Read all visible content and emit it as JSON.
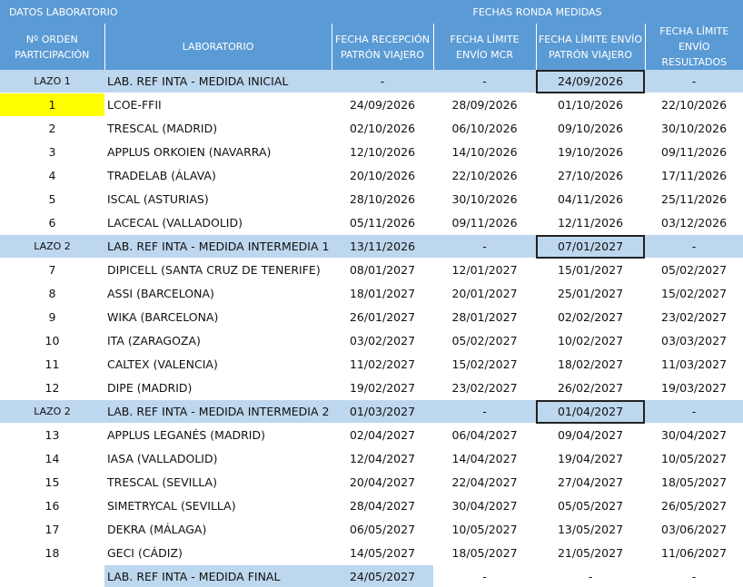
{
  "header": {
    "group_left": "DATOS LABORATORIO",
    "group_right": "FECHAS RONDA MEDIDAS",
    "col_orden": "Nº ORDEN PARTICIPACIÓN",
    "col_lab": "LABORATORIO",
    "col_recepcion": "FECHA RECEPCIÓN PATRÓN VIAJERO",
    "col_mcr": "FECHA LÍMITE ENVÍO MCR",
    "col_envio": "FECHA LÍMITE ENVÍO PATRÓN VIAJERO",
    "col_resultados": "FECHA LÍMITE ENVÍO RESULTADOS"
  },
  "rows": [
    {
      "orden": "LAZO 1",
      "lab": "LAB. REF INTA - MEDIDA INICIAL",
      "recepcion": "-",
      "mcr": "-",
      "envio": "24/09/2026",
      "resultados": "-"
    },
    {
      "orden": "1",
      "lab": "LCOE-FFII",
      "recepcion": "24/09/2026",
      "mcr": "28/09/2026",
      "envio": "01/10/2026",
      "resultados": "22/10/2026"
    },
    {
      "orden": "2",
      "lab": "TRESCAL (MADRID)",
      "recepcion": "02/10/2026",
      "mcr": "06/10/2026",
      "envio": "09/10/2026",
      "resultados": "30/10/2026"
    },
    {
      "orden": "3",
      "lab": "APPLUS ORKOIEN (NAVARRA)",
      "recepcion": "12/10/2026",
      "mcr": "14/10/2026",
      "envio": "19/10/2026",
      "resultados": "09/11/2026"
    },
    {
      "orden": "4",
      "lab": "TRADELAB (ÁLAVA)",
      "recepcion": "20/10/2026",
      "mcr": "22/10/2026",
      "envio": "27/10/2026",
      "resultados": "17/11/2026"
    },
    {
      "orden": "5",
      "lab": "ISCAL (ASTURIAS)",
      "recepcion": "28/10/2026",
      "mcr": "30/10/2026",
      "envio": "04/11/2026",
      "resultados": "25/11/2026"
    },
    {
      "orden": "6",
      "lab": "LACECAL (VALLADOLID)",
      "recepcion": "05/11/2026",
      "mcr": "09/11/2026",
      "envio": "12/11/2026",
      "resultados": "03/12/2026"
    },
    {
      "orden": "LAZO 2",
      "lab": "LAB. REF INTA - MEDIDA INTERMEDIA 1",
      "recepcion": "13/11/2026",
      "mcr": "-",
      "envio": "07/01/2027",
      "resultados": "-"
    },
    {
      "orden": "7",
      "lab": "DIPICELL (SANTA CRUZ DE TENERIFE)",
      "recepcion": "08/01/2027",
      "mcr": "12/01/2027",
      "envio": "15/01/2027",
      "resultados": "05/02/2027"
    },
    {
      "orden": "8",
      "lab": "ASSI (BARCELONA)",
      "recepcion": "18/01/2027",
      "mcr": "20/01/2027",
      "envio": "25/01/2027",
      "resultados": "15/02/2027"
    },
    {
      "orden": "9",
      "lab": "WIKA (BARCELONA)",
      "recepcion": "26/01/2027",
      "mcr": "28/01/2027",
      "envio": "02/02/2027",
      "resultados": "23/02/2027"
    },
    {
      "orden": "10",
      "lab": "ITA (ZARAGOZA)",
      "recepcion": "03/02/2027",
      "mcr": "05/02/2027",
      "envio": "10/02/2027",
      "resultados": "03/03/2027"
    },
    {
      "orden": "11",
      "lab": "CALTEX (VALENCIA)",
      "recepcion": "11/02/2027",
      "mcr": "15/02/2027",
      "envio": "18/02/2027",
      "resultados": "11/03/2027"
    },
    {
      "orden": "12",
      "lab": "DIPE (MADRID)",
      "recepcion": "19/02/2027",
      "mcr": "23/02/2027",
      "envio": "26/02/2027",
      "resultados": "19/03/2027"
    },
    {
      "orden": "LAZO 2",
      "lab": "LAB. REF INTA - MEDIDA INTERMEDIA 2",
      "recepcion": "01/03/2027",
      "mcr": "-",
      "envio": "01/04/2027",
      "resultados": "-"
    },
    {
      "orden": "13",
      "lab": "APPLUS LEGANÉS (MADRID)",
      "recepcion": "02/04/2027",
      "mcr": "06/04/2027",
      "envio": "09/04/2027",
      "resultados": "30/04/2027"
    },
    {
      "orden": "14",
      "lab": "IASA (VALLADOLID)",
      "recepcion": "12/04/2027",
      "mcr": "14/04/2027",
      "envio": "19/04/2027",
      "resultados": "10/05/2027"
    },
    {
      "orden": "15",
      "lab": "TRESCAL (SEVILLA)",
      "recepcion": "20/04/2027",
      "mcr": "22/04/2027",
      "envio": "27/04/2027",
      "resultados": "18/05/2027"
    },
    {
      "orden": "16",
      "lab": "SIMETRYCAL (SEVILLA)",
      "recepcion": "28/04/2027",
      "mcr": "30/04/2027",
      "envio": "05/05/2027",
      "resultados": "26/05/2027"
    },
    {
      "orden": "17",
      "lab": "DEKRA (MÁLAGA)",
      "recepcion": "06/05/2027",
      "mcr": "10/05/2027",
      "envio": "13/05/2027",
      "resultados": "03/06/2027"
    },
    {
      "orden": "18",
      "lab": "GECI (CÁDIZ)",
      "recepcion": "14/05/2027",
      "mcr": "18/05/2027",
      "envio": "21/05/2027",
      "resultados": "11/06/2027"
    },
    {
      "orden": "",
      "lab": "LAB. REF INTA - MEDIDA FINAL",
      "recepcion": "24/05/2027",
      "mcr": "-",
      "envio": "-",
      "resultados": "-"
    }
  ]
}
